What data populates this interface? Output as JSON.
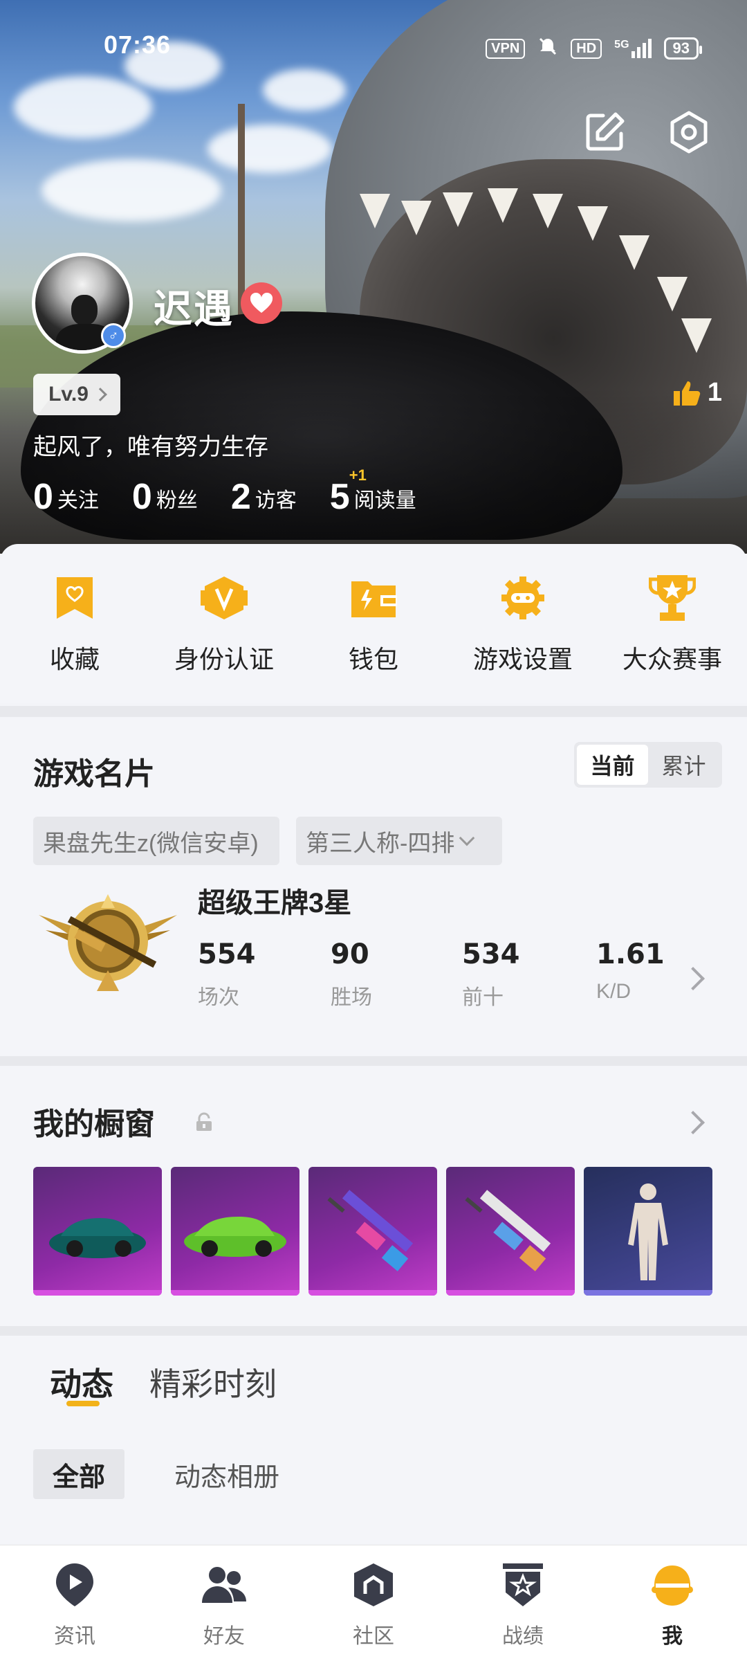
{
  "status_bar": {
    "time": "07:36",
    "vpn": "VPN",
    "hd": "HD",
    "network": "5G",
    "battery": "93"
  },
  "profile": {
    "nickname": "迟遇",
    "level": "Lv.9",
    "bio": "起风了，唯有努力生存",
    "likes": "1",
    "stats": [
      {
        "value": "0",
        "label": "关注"
      },
      {
        "value": "0",
        "label": "粉丝"
      },
      {
        "value": "2",
        "label": "访客"
      },
      {
        "value": "5",
        "label": "阅读量",
        "delta": "+1"
      }
    ]
  },
  "quick_menu": [
    {
      "label": "收藏",
      "icon": "bookmark-icon"
    },
    {
      "label": "身份认证",
      "icon": "verify-icon"
    },
    {
      "label": "钱包",
      "icon": "wallet-icon"
    },
    {
      "label": "游戏设置",
      "icon": "gamepad-gear-icon"
    },
    {
      "label": "大众赛事",
      "icon": "trophy-icon"
    }
  ],
  "game_card": {
    "title": "游戏名片",
    "toggle": {
      "current": "当前",
      "cumulative": "累计"
    },
    "account": "果盘先生z(微信安卓)",
    "mode": "第三人称-四排",
    "rank": "超级王牌3星",
    "stats": [
      {
        "value": "554",
        "label": "场次"
      },
      {
        "value": "90",
        "label": "胜场"
      },
      {
        "value": "534",
        "label": "前十"
      },
      {
        "value": "1.61",
        "label": "K/D"
      }
    ]
  },
  "showcase": {
    "title": "我的橱窗",
    "items": [
      "dark-green-sports-car",
      "green-supercar",
      "purple-rifle-skin",
      "blue-rifle-skin",
      "white-outfit"
    ]
  },
  "feed": {
    "tabs": [
      "动态",
      "精彩时刻"
    ],
    "subtabs": [
      "全部",
      "动态相册"
    ]
  },
  "bottom_nav": [
    {
      "label": "资讯",
      "icon": "news-icon"
    },
    {
      "label": "好友",
      "icon": "friends-icon"
    },
    {
      "label": "社区",
      "icon": "community-icon"
    },
    {
      "label": "战绩",
      "icon": "record-icon"
    },
    {
      "label": "我",
      "icon": "me-icon"
    }
  ],
  "colors": {
    "accent": "#f6b01a",
    "heart": "#f05a5f",
    "gender": "#4e8ce8"
  }
}
